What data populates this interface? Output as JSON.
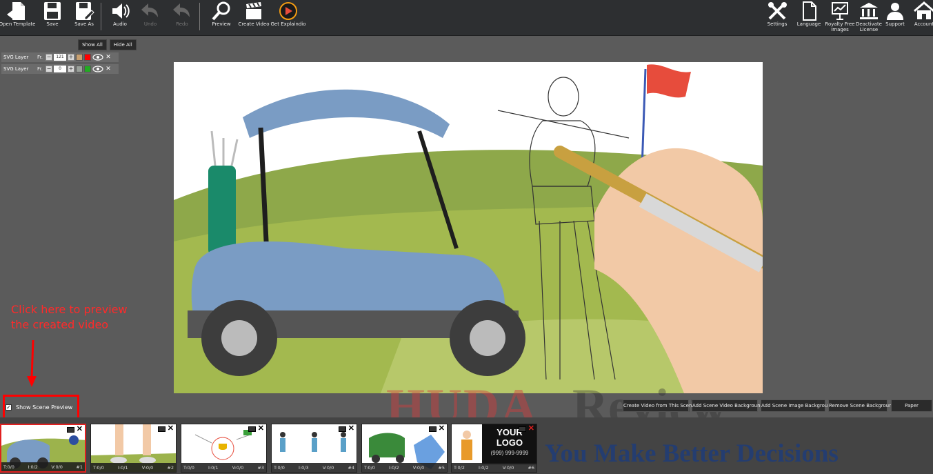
{
  "toolbar": {
    "open_template": "Open Template",
    "save": "Save",
    "save_as": "Save As",
    "audio": "Audio",
    "undo": "Undo",
    "redo": "Redo",
    "preview": "Preview",
    "create_video": "Create Video",
    "get_explaindio": "Get Explaindio",
    "settings": "Settings",
    "language": "Language",
    "royalty_free_1": "Royalty Free",
    "royalty_free_2": "Images",
    "deactivate_1": "Deactivate",
    "deactivate_2": "License",
    "support": "Support",
    "account": "Account"
  },
  "layers": {
    "show_all": "Show All",
    "hide_all": "Hide All",
    "fr_label": "Fr.",
    "items": [
      {
        "name": "SVG Layer",
        "frame": "121",
        "color": "#ff0000"
      },
      {
        "name": "SVG Layer",
        "frame": "0",
        "color": "#22aa22"
      }
    ]
  },
  "annotation": {
    "line1": "Click here to preview",
    "line2": "the created video"
  },
  "show_scene_preview": "Show Scene Preview",
  "scene_buttons": {
    "create_from_scene": "Create Video from This Scene",
    "add_video_bg": "Add Scene Video Background",
    "add_image_bg": "Add Scene Image Background",
    "remove_bg": "Remove Scene Background",
    "paper": "Paper"
  },
  "scenes": [
    {
      "t": "T:0/0",
      "i": "I:0/2",
      "v": "V:0/0",
      "num": "#1"
    },
    {
      "t": "T:0/0",
      "i": "I:0/1",
      "v": "V:0/0",
      "num": "#2"
    },
    {
      "t": "T:0/0",
      "i": "I:0/1",
      "v": "V:0/0",
      "num": "#3"
    },
    {
      "t": "T:0/0",
      "i": "I:0/3",
      "v": "V:0/0",
      "num": "#4"
    },
    {
      "t": "T:0/0",
      "i": "I:0/2",
      "v": "V:0/0",
      "num": "#5"
    },
    {
      "t": "T:0/2",
      "i": "I:0/2",
      "v": "V:0/0",
      "num": "#6"
    }
  ],
  "scene6_logo": {
    "line1": "YOUR",
    "line2": "LOGO",
    "phone": "(999) 999-9999"
  },
  "watermark": {
    "huda": "HUDA",
    "review": "Review",
    "tagline": "You Make Better Decisions"
  }
}
